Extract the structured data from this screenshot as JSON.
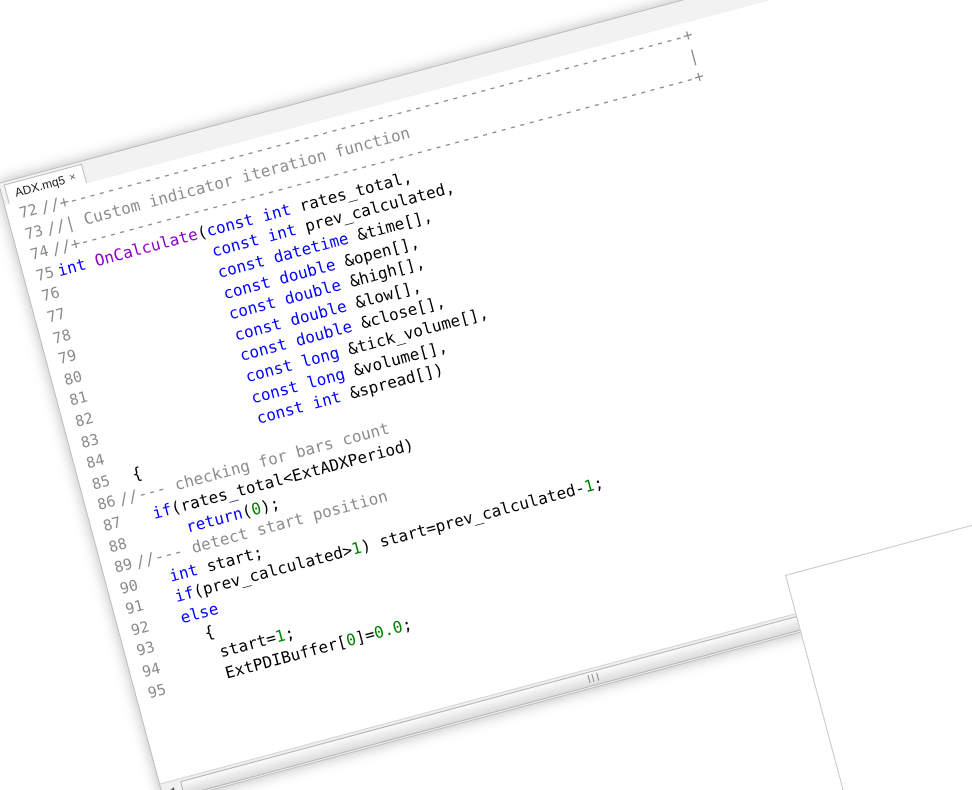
{
  "tab": {
    "filename": "ADX.mq5",
    "close_glyph": "×"
  },
  "colors": {
    "comment": "#8c8c8c",
    "keyword": "#0000ff",
    "function": "#8a00c8",
    "number": "#008000",
    "line_number": "#8a8a8a"
  },
  "header_decoration": {
    "border_line": "//+------------------------------------------------------------------+",
    "bar_line": "//|                                                                  |"
  },
  "code_lines": [
    {
      "num": "72",
      "tokens": [
        {
          "t": "//+------------------------------------------------------------------+",
          "c": "comment"
        }
      ]
    },
    {
      "num": "73",
      "tokens": [
        {
          "t": "//| Custom indicator iteration function                              |",
          "c": "comment"
        }
      ]
    },
    {
      "num": "74",
      "tokens": [
        {
          "t": "//+------------------------------------------------------------------+",
          "c": "comment"
        }
      ]
    },
    {
      "num": "75",
      "tokens": [
        {
          "t": "int ",
          "c": "keyword"
        },
        {
          "t": "OnCalculate",
          "c": "function"
        },
        {
          "t": "(",
          "c": "plain"
        },
        {
          "t": "const int ",
          "c": "keyword"
        },
        {
          "t": "rates_total,",
          "c": "plain"
        }
      ]
    },
    {
      "num": "76",
      "tokens": [
        {
          "t": "                const int ",
          "c": "keyword"
        },
        {
          "t": "prev_calculated,",
          "c": "plain"
        }
      ]
    },
    {
      "num": "77",
      "tokens": [
        {
          "t": "                const datetime ",
          "c": "keyword"
        },
        {
          "t": "&time[],",
          "c": "plain"
        }
      ]
    },
    {
      "num": "78",
      "tokens": [
        {
          "t": "                const double ",
          "c": "keyword"
        },
        {
          "t": "&open[],",
          "c": "plain"
        }
      ]
    },
    {
      "num": "79",
      "tokens": [
        {
          "t": "                const double ",
          "c": "keyword"
        },
        {
          "t": "&high[],",
          "c": "plain"
        }
      ]
    },
    {
      "num": "80",
      "tokens": [
        {
          "t": "                const double ",
          "c": "keyword"
        },
        {
          "t": "&low[],",
          "c": "plain"
        }
      ]
    },
    {
      "num": "81",
      "tokens": [
        {
          "t": "                const double ",
          "c": "keyword"
        },
        {
          "t": "&close[],",
          "c": "plain"
        }
      ]
    },
    {
      "num": "82",
      "tokens": [
        {
          "t": "                const long ",
          "c": "keyword"
        },
        {
          "t": "&tick_volume[],",
          "c": "plain"
        }
      ]
    },
    {
      "num": "83",
      "tokens": [
        {
          "t": "                const long ",
          "c": "keyword"
        },
        {
          "t": "&volume[],",
          "c": "plain"
        }
      ]
    },
    {
      "num": "84",
      "tokens": [
        {
          "t": "                const int ",
          "c": "keyword"
        },
        {
          "t": "&spread[])",
          "c": "plain"
        }
      ]
    },
    {
      "num": "85",
      "tokens": [
        {
          "t": "  {",
          "c": "plain"
        }
      ]
    },
    {
      "num": "86",
      "tokens": [
        {
          "t": "//--- checking for bars count",
          "c": "comment"
        }
      ]
    },
    {
      "num": "87",
      "tokens": [
        {
          "t": "   ",
          "c": "plain"
        },
        {
          "t": "if",
          "c": "keyword"
        },
        {
          "t": "(rates_total<ExtADXPeriod)",
          "c": "plain"
        }
      ]
    },
    {
      "num": "88",
      "tokens": [
        {
          "t": "      ",
          "c": "plain"
        },
        {
          "t": "return",
          "c": "keyword"
        },
        {
          "t": "(",
          "c": "plain"
        },
        {
          "t": "0",
          "c": "number"
        },
        {
          "t": ");",
          "c": "plain"
        }
      ]
    },
    {
      "num": "89",
      "tokens": [
        {
          "t": "//--- detect start position",
          "c": "comment"
        }
      ]
    },
    {
      "num": "90",
      "tokens": [
        {
          "t": "   ",
          "c": "plain"
        },
        {
          "t": "int ",
          "c": "keyword"
        },
        {
          "t": "start;",
          "c": "plain"
        }
      ]
    },
    {
      "num": "91",
      "tokens": [
        {
          "t": "   ",
          "c": "plain"
        },
        {
          "t": "if",
          "c": "keyword"
        },
        {
          "t": "(prev_calculated>",
          "c": "plain"
        },
        {
          "t": "1",
          "c": "number"
        },
        {
          "t": ") start=prev_calculated-",
          "c": "plain"
        },
        {
          "t": "1",
          "c": "number"
        },
        {
          "t": ";",
          "c": "plain"
        }
      ]
    },
    {
      "num": "92",
      "tokens": [
        {
          "t": "   ",
          "c": "plain"
        },
        {
          "t": "else",
          "c": "keyword"
        }
      ]
    },
    {
      "num": "93",
      "tokens": [
        {
          "t": "     {",
          "c": "plain"
        }
      ]
    },
    {
      "num": "94",
      "tokens": [
        {
          "t": "      start=",
          "c": "plain"
        },
        {
          "t": "1",
          "c": "number"
        },
        {
          "t": ";",
          "c": "plain"
        }
      ]
    },
    {
      "num": "95",
      "tokens": [
        {
          "t": "      ExtPDIBuffer[",
          "c": "plain"
        },
        {
          "t": "0",
          "c": "number"
        },
        {
          "t": "]=",
          "c": "plain"
        },
        {
          "t": "0.0",
          "c": "number"
        },
        {
          "t": ";",
          "c": "plain"
        }
      ]
    }
  ],
  "scrollbar": {
    "left_arrow": "◂"
  }
}
